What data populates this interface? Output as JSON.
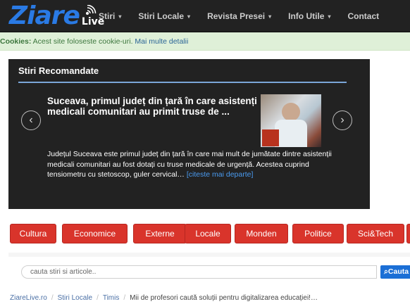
{
  "brand": {
    "logo_main": "Ziare",
    "logo_sub": "Live",
    "logo_color": "#2a7ae4"
  },
  "nav": {
    "items": [
      {
        "label": "Stiri",
        "caret": "▾"
      },
      {
        "label": "Stiri Locale",
        "caret": "▾"
      },
      {
        "label": "Revista Presei",
        "caret": "▾"
      },
      {
        "label": "Info Utile",
        "caret": "▾"
      },
      {
        "label": "Contact",
        "caret": ""
      }
    ]
  },
  "cookie_bar": {
    "label": "Cookies:",
    "text": " Acest site foloseste cookie-uri. ",
    "link": "Mai multe detalii"
  },
  "recommended": {
    "title": "Stiri Recomandate",
    "headline": "Suceava, primul județ din țară în care asistenți medicali comunitari au primit truse de ...",
    "body": "Județul Suceava este primul județ din țară în care mai mult de jumătate dintre asistenții medicali comunitari au fost dotați cu truse medicale de urgență. Acestea cuprind tensiometru cu stetoscop, guler cervical… ",
    "read_more": "[citeste mai departe]",
    "prev_icon": "chevron-left-icon",
    "next_icon": "chevron-right-icon"
  },
  "categories": [
    "Cultura",
    "Economice",
    "Externe",
    "Locale",
    "Monden",
    "Politice",
    "Sci&Tech"
  ],
  "search": {
    "placeholder": "cauta stiri si articole..",
    "value": "",
    "button_label": "Cauta",
    "button_icon": "search-icon"
  },
  "breadcrumb": {
    "items": [
      "ZiareLive.ro",
      "Stiri Locale",
      "Timis",
      "Mii de profesori caută soluții pentru digitalizarea educației!…"
    ],
    "separator": "/"
  },
  "colors": {
    "nav_bg": "#222222",
    "cookie_bg": "#dff0d8",
    "category_red": "#d9342b",
    "search_blue": "#1b6fd6"
  }
}
